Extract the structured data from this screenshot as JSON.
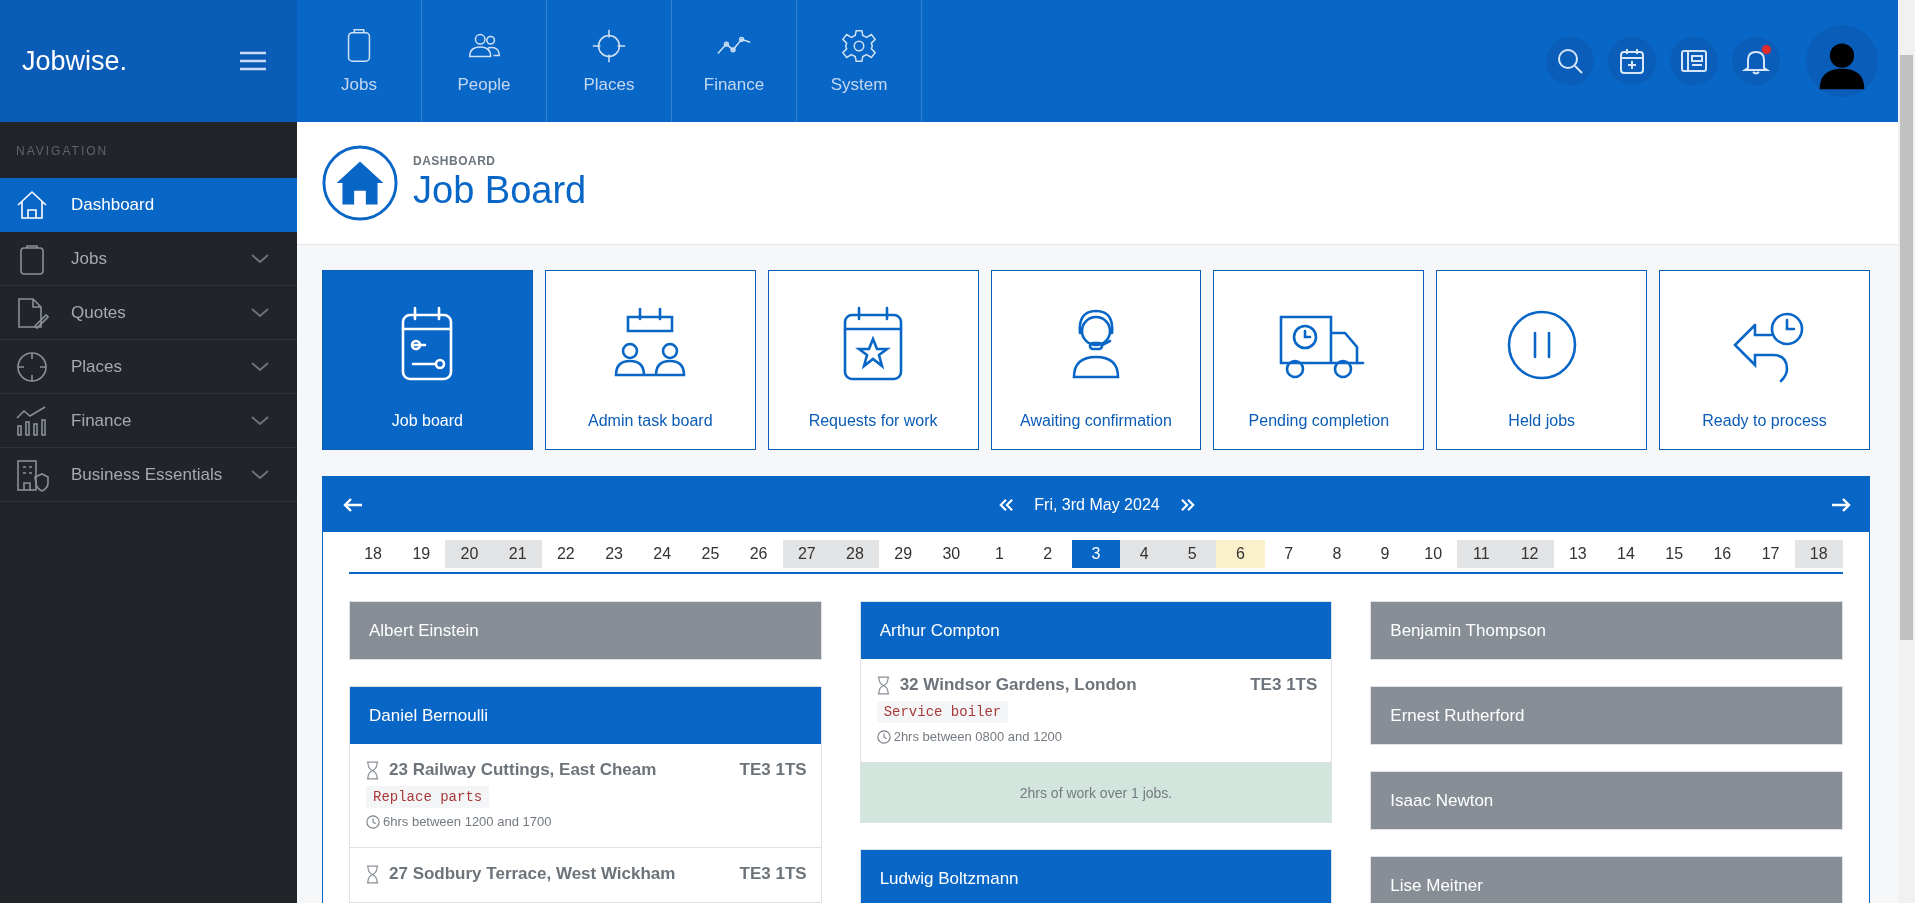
{
  "brand": {
    "name": "Jobwise."
  },
  "top_nav": [
    {
      "label": "Jobs"
    },
    {
      "label": "People"
    },
    {
      "label": "Places"
    },
    {
      "label": "Finance"
    },
    {
      "label": "System"
    }
  ],
  "notifications": {
    "unread": true
  },
  "sidebar": {
    "heading": "NAVIGATION",
    "items": [
      {
        "label": "Dashboard",
        "selected": true,
        "expandable": false
      },
      {
        "label": "Jobs",
        "selected": false,
        "expandable": true
      },
      {
        "label": "Quotes",
        "selected": false,
        "expandable": true
      },
      {
        "label": "Places",
        "selected": false,
        "expandable": true
      },
      {
        "label": "Finance",
        "selected": false,
        "expandable": true
      },
      {
        "label": "Business Essentials",
        "selected": false,
        "expandable": true
      }
    ]
  },
  "header": {
    "breadcrumb": "DASHBOARD",
    "title": "Job Board"
  },
  "tiles": [
    {
      "label": "Job board",
      "selected": true
    },
    {
      "label": "Admin task board",
      "selected": false
    },
    {
      "label": "Requests for work",
      "selected": false
    },
    {
      "label": "Awaiting confirmation",
      "selected": false
    },
    {
      "label": "Pending completion",
      "selected": false
    },
    {
      "label": "Held jobs",
      "selected": false
    },
    {
      "label": "Ready to process",
      "selected": false
    }
  ],
  "calendar": {
    "date": "Fri, 3rd May 2024",
    "days": [
      {
        "label": "18",
        "kind": "weekday",
        "selected": false
      },
      {
        "label": "19",
        "kind": "weekday",
        "selected": false
      },
      {
        "label": "20",
        "kind": "weekend",
        "selected": false
      },
      {
        "label": "21",
        "kind": "weekend",
        "selected": false
      },
      {
        "label": "22",
        "kind": "weekday",
        "selected": false
      },
      {
        "label": "23",
        "kind": "weekday",
        "selected": false
      },
      {
        "label": "24",
        "kind": "weekday",
        "selected": false
      },
      {
        "label": "25",
        "kind": "weekday",
        "selected": false
      },
      {
        "label": "26",
        "kind": "weekday",
        "selected": false
      },
      {
        "label": "27",
        "kind": "weekend",
        "selected": false
      },
      {
        "label": "28",
        "kind": "weekend",
        "selected": false
      },
      {
        "label": "29",
        "kind": "weekday",
        "selected": false
      },
      {
        "label": "30",
        "kind": "weekday",
        "selected": false
      },
      {
        "label": "1",
        "kind": "weekday",
        "selected": false
      },
      {
        "label": "2",
        "kind": "weekday",
        "selected": false
      },
      {
        "label": "3",
        "kind": "weekday",
        "selected": true
      },
      {
        "label": "4",
        "kind": "weekend",
        "selected": false
      },
      {
        "label": "5",
        "kind": "weekend",
        "selected": false
      },
      {
        "label": "6",
        "kind": "holiday",
        "selected": false
      },
      {
        "label": "7",
        "kind": "weekday",
        "selected": false
      },
      {
        "label": "8",
        "kind": "weekday",
        "selected": false
      },
      {
        "label": "9",
        "kind": "weekday",
        "selected": false
      },
      {
        "label": "10",
        "kind": "weekday",
        "selected": false
      },
      {
        "label": "11",
        "kind": "weekend",
        "selected": false
      },
      {
        "label": "12",
        "kind": "weekend",
        "selected": false
      },
      {
        "label": "13",
        "kind": "weekday",
        "selected": false
      },
      {
        "label": "14",
        "kind": "weekday",
        "selected": false
      },
      {
        "label": "15",
        "kind": "weekday",
        "selected": false
      },
      {
        "label": "16",
        "kind": "weekday",
        "selected": false
      },
      {
        "label": "17",
        "kind": "weekday",
        "selected": false
      },
      {
        "label": "18",
        "kind": "weekend",
        "selected": false
      }
    ]
  },
  "columns": [
    [
      {
        "name": "Albert Einstein",
        "active": false
      },
      {
        "name": "Daniel Bernoulli",
        "active": true,
        "jobs": [
          {
            "address": "23 Railway Cuttings, East Cheam",
            "postcode": "TE3 1TS",
            "task": "Replace parts",
            "time": "6hrs between 1200 and 1700"
          },
          {
            "address": "27 Sodbury Terrace, West Wickham",
            "postcode": "TE3 1TS"
          }
        ]
      }
    ],
    [
      {
        "name": "Arthur Compton",
        "active": true,
        "jobs": [
          {
            "address": "32 Windsor Gardens, London",
            "postcode": "TE3 1TS",
            "task": "Service boiler",
            "time": "2hrs between 0800 and 1200"
          }
        ],
        "summary": "2hrs of work over 1 jobs."
      },
      {
        "name": "Ludwig Boltzmann",
        "active": true
      }
    ],
    [
      {
        "name": "Benjamin Thompson",
        "active": false
      },
      {
        "name": "Ernest Rutherford",
        "active": false
      },
      {
        "name": "Isaac Newton",
        "active": false
      },
      {
        "name": "Lise Meitner",
        "active": false
      }
    ]
  ]
}
